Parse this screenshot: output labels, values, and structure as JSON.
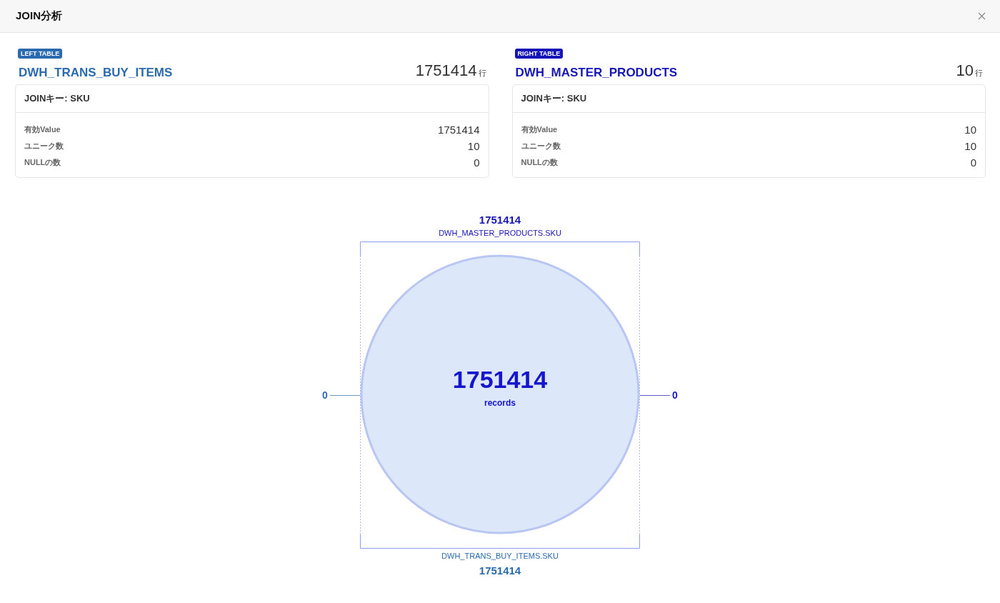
{
  "window": {
    "title": "JOIN分析"
  },
  "tables": [
    {
      "badge": "LEFT TABLE",
      "name": "DWH_TRANS_BUY_ITEMS",
      "count": "1751414",
      "unit": "行",
      "color": "#2a6bb0",
      "key": "JOINキー: SKU",
      "stats": [
        {
          "label": "有効Value",
          "value": "1751414"
        },
        {
          "label": "ユニーク数",
          "value": "10"
        },
        {
          "label": "NULLの数",
          "value": "0"
        }
      ]
    },
    {
      "badge": "RIGHT TABLE",
      "name": "DWH_MASTER_PRODUCTS",
      "count": "10",
      "unit": "行",
      "color": "#1515b8",
      "key": "JOINキー: SKU",
      "stats": [
        {
          "label": "有効Value",
          "value": "10"
        },
        {
          "label": "ユニーク数",
          "value": "10"
        },
        {
          "label": "NULLの数",
          "value": "0"
        }
      ]
    }
  ],
  "diagram": {
    "top_count": "1751414",
    "top_label": "DWH_MASTER_PRODUCTS.SKU",
    "left_only": "0",
    "right_only": "0",
    "center_count": "1751414",
    "center_unit": "records",
    "bottom_label": "DWH_TRANS_BUY_ITEMS.SKU",
    "bottom_count": "1751414"
  }
}
